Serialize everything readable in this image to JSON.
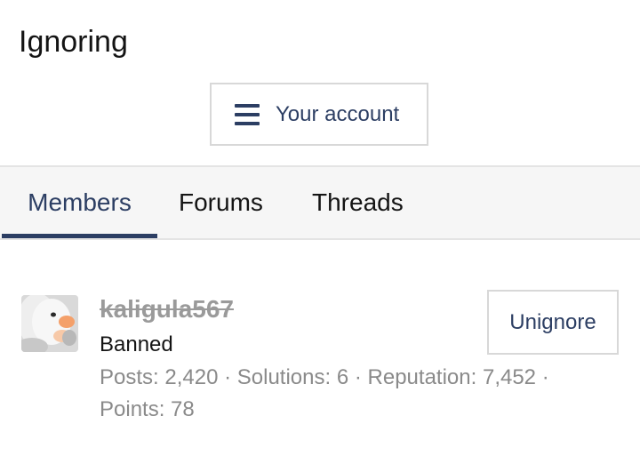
{
  "page": {
    "title": "Ignoring"
  },
  "account_button": {
    "icon": "menu-icon",
    "label": "Your account"
  },
  "tabs": [
    {
      "label": "Members",
      "active": true
    },
    {
      "label": "Forums",
      "active": false
    },
    {
      "label": "Threads",
      "active": false
    }
  ],
  "members": [
    {
      "username": "kaligula567",
      "title": "Banned",
      "stats": {
        "posts_label": "Posts:",
        "posts": "2,420",
        "solutions_label": "Solutions:",
        "solutions": "6",
        "reputation_label": "Reputation:",
        "reputation": "7,452",
        "points_label": "Points:",
        "points": "78",
        "separator": " · "
      },
      "action_label": "Unignore"
    }
  ],
  "colors": {
    "accent": "#2c3e63",
    "muted_text": "#8a8a8a",
    "border": "#d8d8d8",
    "tab_bar_bg": "#f6f6f6"
  }
}
